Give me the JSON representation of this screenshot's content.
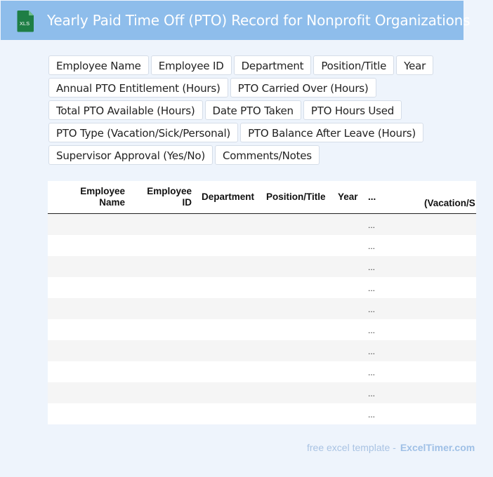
{
  "header": {
    "icon_label": "XLS",
    "title": "Yearly Paid Time Off (PTO) Record for Nonprofit Organizations"
  },
  "fields": [
    [
      "Employee Name",
      "Employee ID",
      "Department",
      "Position/Title",
      "Year"
    ],
    [
      "Annual PTO Entitlement (Hours)",
      "PTO Carried Over (Hours)"
    ],
    [
      "Total PTO Available (Hours)",
      "Date PTO Taken",
      "PTO Hours Used"
    ],
    [
      "PTO Type (Vacation/Sick/Personal)",
      "PTO Balance After Leave (Hours)"
    ],
    [
      "Supervisor Approval (Yes/No)",
      "Comments/Notes"
    ]
  ],
  "table": {
    "columns": {
      "employee_name_1": "Employee",
      "employee_name_2": "Name",
      "employee_id_1": "Employee",
      "employee_id_2": "ID",
      "department": "Department",
      "position_title": "Position/Title",
      "year": "Year",
      "more": "...",
      "vacation": "(Vacation/S"
    },
    "row_count": 10,
    "cell_ellipsis": "..."
  },
  "footer": {
    "text": "free excel template -",
    "brand": "ExcelTimer.com"
  },
  "colors": {
    "header_bg": "#8ebdeb",
    "page_bg": "#eef4fc",
    "icon_green": "#1e7e45"
  }
}
